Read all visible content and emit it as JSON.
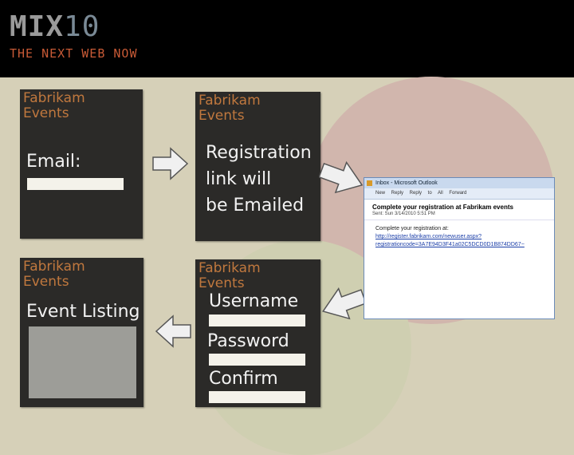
{
  "header": {
    "logo_mix": "MIX",
    "logo_number": "10",
    "tagline": "THE NEXT WEB NOW"
  },
  "brand": {
    "line1": "Fabrikam",
    "line2": "Events"
  },
  "panels": {
    "email": {
      "label": "Email:"
    },
    "registration": {
      "line1": "Registration",
      "line2": "link will",
      "line3": "be Emailed"
    },
    "listing": {
      "label": "Event Listing"
    },
    "signup": {
      "username": "Username",
      "password": "Password",
      "confirm": "Confirm"
    }
  },
  "outlook": {
    "window_title": "Inbox - Microsoft Outlook",
    "toolbar": "New  Reply  Reply to All  Forward",
    "subject": "Complete your registration at Fabrikam events",
    "sent": "Sent: Sun 3/14/2010 5:51 PM",
    "body_intro": "Complete your registration at:",
    "link_line1": "http://register.fabrikam.com/newuser.aspx?",
    "link_line2": "registrationcode=3A7E94D3F41a02C5DCD0D1B874DD67~"
  }
}
